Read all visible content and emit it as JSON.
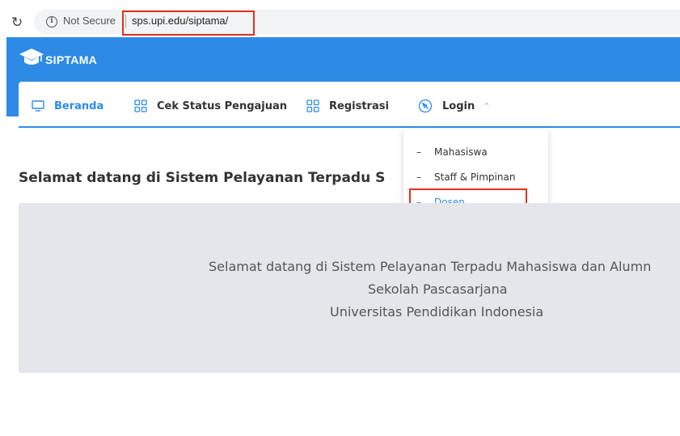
{
  "browser": {
    "security_label": "Not Secure",
    "url": "sps.upi.edu/siptama/"
  },
  "header": {
    "logo_text": "SIPTAMA"
  },
  "nav": {
    "items": [
      {
        "label": "Beranda",
        "icon": "monitor-icon"
      },
      {
        "label": "Cek Status Pengajuan",
        "icon": "grid-icon"
      },
      {
        "label": "Registrasi",
        "icon": "grid-icon"
      },
      {
        "label": "Login",
        "icon": "compass-icon"
      }
    ]
  },
  "dropdown": {
    "items": [
      {
        "label": "Mahasiswa"
      },
      {
        "label": "Staff & Pimpinan"
      },
      {
        "label": "Dosen"
      }
    ]
  },
  "main": {
    "title": "Selamat datang di Sistem Pelayanan Terpadu S",
    "panel_lines": [
      "Selamat datang di Sistem Pelayanan Terpadu Mahasiswa dan Alumn",
      "Sekolah Pascasarjana",
      "Universitas Pendidikan Indonesia"
    ]
  },
  "colors": {
    "brand_blue": "#2d8be6",
    "highlight_red": "#e0301e",
    "panel_gray": "#e4e6eb"
  }
}
